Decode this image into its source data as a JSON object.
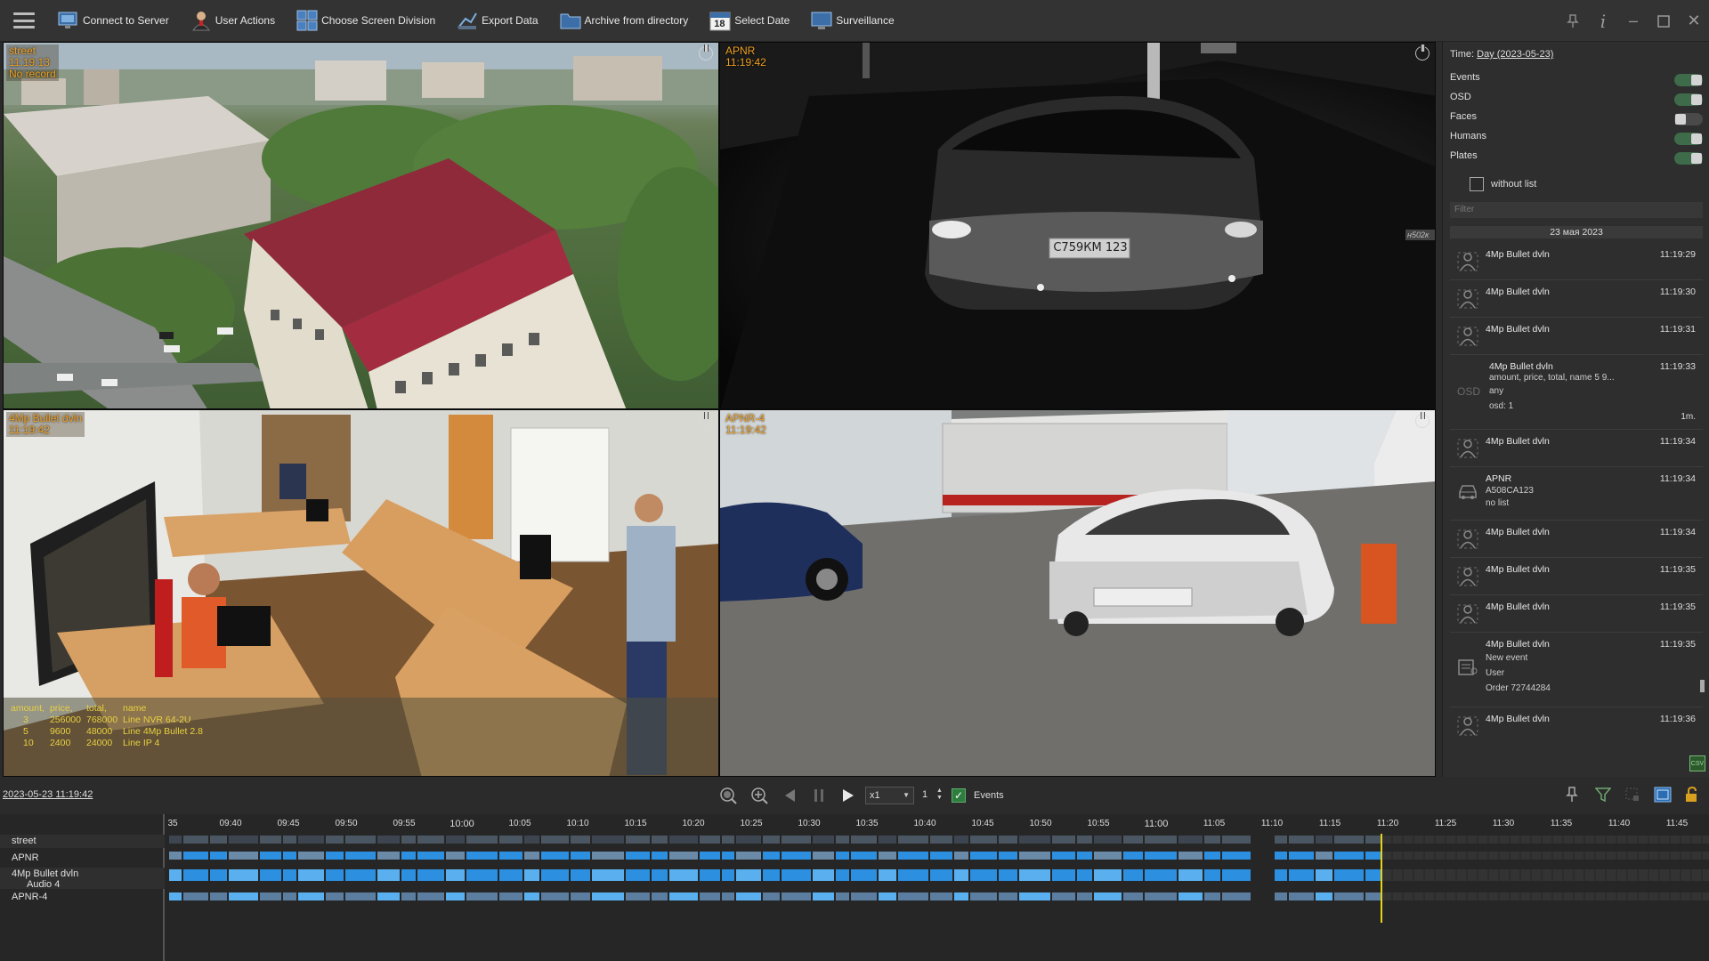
{
  "toolbar": {
    "items": [
      {
        "label": "Connect to Server",
        "icon": "server-connect-icon"
      },
      {
        "label": "User Actions",
        "icon": "user-icon"
      },
      {
        "label": "Choose Screen Division",
        "icon": "grid-layout-icon"
      },
      {
        "label": "Export Data",
        "icon": "export-icon"
      },
      {
        "label": "Archive from directory",
        "icon": "folder-icon"
      },
      {
        "label": "Select Date",
        "icon": "calendar-icon",
        "calendar_day": "18"
      },
      {
        "label": "Surveillance",
        "icon": "monitor-icon"
      }
    ]
  },
  "tiles": [
    {
      "name": "street",
      "time": "11:19:13",
      "status": "No record"
    },
    {
      "name": "APNR",
      "time": "11:19:42",
      "status": ""
    },
    {
      "name": "4Mp Bullet dvln",
      "time": "11:19:42",
      "status": ""
    },
    {
      "name": "APNR-4",
      "time": "11:19:42",
      "status": ""
    }
  ],
  "apnr_plate": "С759КМ 123",
  "apnr_corner": "н502к",
  "overlay": {
    "headers": [
      "amount,",
      "price,",
      "total,",
      "name"
    ],
    "rows": [
      [
        "3",
        "256000",
        "768000",
        "Line NVR 64-2U"
      ],
      [
        "5",
        "9600",
        "48000",
        "Line 4Mp Bullet 2.8"
      ],
      [
        "10",
        "2400",
        "24000",
        "Line IP 4"
      ]
    ]
  },
  "right_panel": {
    "time_label": "Time:",
    "time_value": "Day (2023-05-23)",
    "toggles": [
      {
        "label": "Events",
        "on": true
      },
      {
        "label": "OSD",
        "on": true
      },
      {
        "label": "Faces",
        "on": false
      },
      {
        "label": "Humans",
        "on": true
      },
      {
        "label": "Plates",
        "on": true
      }
    ],
    "without_list": "without list",
    "filter_placeholder": "Filter",
    "date_header": "23 мая 2023",
    "events": [
      {
        "title": "4Mp Bullet dvln",
        "time": "11:19:29",
        "lines": [],
        "kind": "human"
      },
      {
        "title": "4Mp Bullet dvln",
        "time": "11:19:30",
        "lines": [],
        "kind": "human"
      },
      {
        "title": "4Mp Bullet dvln",
        "time": "11:19:31",
        "lines": [],
        "kind": "human"
      },
      {
        "title": "4Mp Bullet dvln",
        "time": "11:19:33",
        "lines": [
          "amount,  price,    total,    name      5      9...",
          "any",
          "osd: 1"
        ],
        "kind": "osd",
        "badge": "OSD",
        "extra": "1m."
      },
      {
        "title": "4Mp Bullet dvln",
        "time": "11:19:34",
        "lines": [],
        "kind": "human"
      },
      {
        "title": "APNR",
        "time": "11:19:34",
        "lines": [
          "A508CA123",
          "no list"
        ],
        "kind": "car"
      },
      {
        "title": "4Mp Bullet dvln",
        "time": "11:19:34",
        "lines": [],
        "kind": "human"
      },
      {
        "title": "4Mp Bullet dvln",
        "time": "11:19:35",
        "lines": [],
        "kind": "human"
      },
      {
        "title": "4Mp Bullet dvln",
        "time": "11:19:35",
        "lines": [],
        "kind": "human"
      },
      {
        "title": "4Mp Bullet dvln",
        "time": "11:19:35",
        "lines": [
          "New event",
          "User",
          "Order 72744284"
        ],
        "kind": "user"
      },
      {
        "title": "4Mp Bullet dvln",
        "time": "11:19:36",
        "lines": [],
        "kind": "human"
      }
    ],
    "csv_label": "CSV"
  },
  "playback": {
    "datetime": "2023-05-23 11:19:42",
    "speed": "x1",
    "step": "1",
    "events_label": "Events",
    "events_checked": true
  },
  "timeline": {
    "channels": [
      "street",
      "APNR",
      "4Mp Bullet dvln",
      "Audio 4",
      "APNR-4"
    ],
    "ticks": [
      "35",
      "09:40",
      "09:45",
      "09:50",
      "09:55",
      "10:00",
      "10:05",
      "10:10",
      "10:15",
      "10:20",
      "10:25",
      "10:30",
      "10:35",
      "10:40",
      "10:45",
      "10:50",
      "10:55",
      "11:00",
      "11:05",
      "11:10",
      "11:15",
      "11:20",
      "11:25",
      "11:30",
      "11:35",
      "11:40",
      "11:45"
    ],
    "cursor_time": "11:19:42"
  },
  "colors": {
    "accent_orange": "#f0a020",
    "track_blue": "#2d8fe0",
    "track_light": "#5ab0ef",
    "cursor_yellow": "#e5d21a",
    "toggle_green": "#3e6b4a"
  }
}
